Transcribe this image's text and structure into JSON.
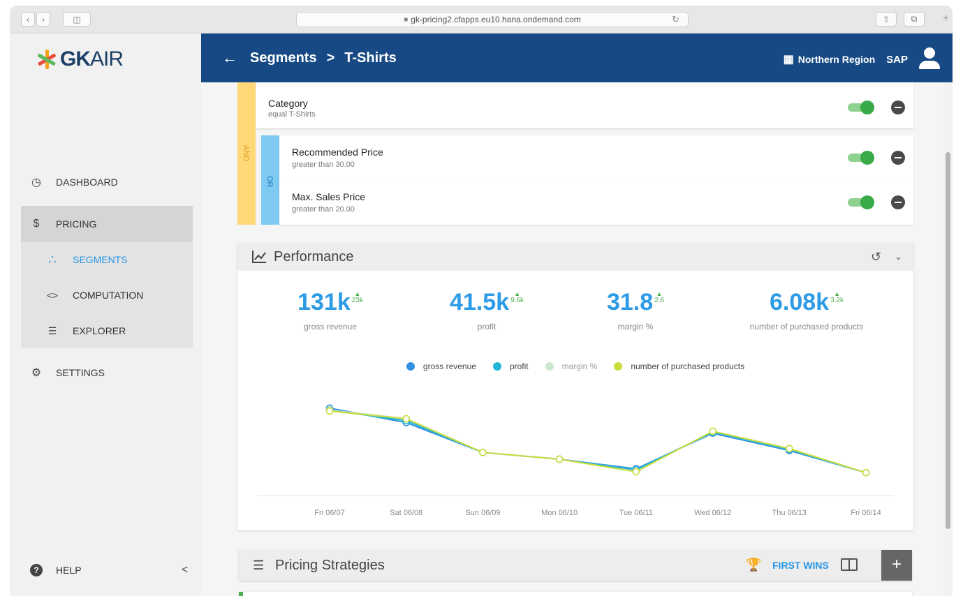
{
  "browser": {
    "url": "gk-pricing2.cfapps.eu10.hana.ondemand.com",
    "lock": "🔒"
  },
  "sidebar": {
    "logo": {
      "bold": "GK",
      "light": "AIR"
    },
    "items": [
      {
        "label": "DASHBOARD",
        "icon": "◷"
      },
      {
        "label": "PRICING",
        "icon": "$"
      },
      {
        "label": "SEGMENTS",
        "icon": "•"
      },
      {
        "label": "COMPUTATION",
        "icon": "<>"
      },
      {
        "label": "EXPLORER",
        "icon": "☰"
      },
      {
        "label": "SETTINGS",
        "icon": "⚙"
      },
      {
        "label": "HELP",
        "icon": "?"
      }
    ],
    "collapse": "<"
  },
  "header": {
    "back": "←",
    "crumb_parent": "Segments",
    "crumb_sep": ">",
    "crumb_current": "T-Shirts",
    "region": "Northern Region",
    "tenant": "SAP"
  },
  "rules": {
    "and_label": "AND",
    "or_label": "OR",
    "items": [
      {
        "title": "Category",
        "condition": "equal T-Shirts"
      },
      {
        "title": "Recommended Price",
        "condition": "greater than 30.00"
      },
      {
        "title": "Max. Sales Price",
        "condition": "greater than 20.00"
      }
    ]
  },
  "performance": {
    "title": "Performance",
    "kpis": [
      {
        "value": "131k",
        "delta": "23k",
        "label": "gross revenue"
      },
      {
        "value": "41.5k",
        "delta": "9.6k",
        "label": "profit"
      },
      {
        "value": "31.8",
        "delta": "2.6",
        "label": "margin %"
      },
      {
        "value": "6.08k",
        "delta": "3.2k",
        "label": "number of purchased products"
      }
    ]
  },
  "chart_data": {
    "type": "line",
    "categories": [
      "Fri 06/07",
      "Sat 06/08",
      "Sun 06/09",
      "Mon 06/10",
      "Tue 06/11",
      "Wed 06/12",
      "Thu 06/13",
      "Fri 06/14"
    ],
    "series": [
      {
        "name": "gross revenue",
        "color": "#2f8fe0",
        "values": [
          0.82,
          0.67,
          0.36,
          0.29,
          0.19,
          0.56,
          0.38,
          0.15
        ]
      },
      {
        "name": "profit",
        "color": "#22b5d6",
        "values": [
          0.8,
          0.69,
          0.36,
          0.29,
          0.18,
          0.57,
          0.39,
          0.15
        ]
      },
      {
        "name": "margin %",
        "color": "#b8e0b8",
        "values": [
          0.8,
          0.71,
          0.36,
          0.29,
          0.16,
          0.58,
          0.4,
          0.15
        ]
      },
      {
        "name": "number of purchased products",
        "color": "#c9dc3a",
        "values": [
          0.79,
          0.71,
          0.36,
          0.29,
          0.16,
          0.58,
          0.4,
          0.15
        ]
      }
    ],
    "ylim": [
      0,
      1
    ],
    "grid": false,
    "legend": "top-center"
  },
  "pricing_strategies": {
    "title": "Pricing Strategies",
    "mode": "FIRST WINS",
    "add": "+"
  }
}
